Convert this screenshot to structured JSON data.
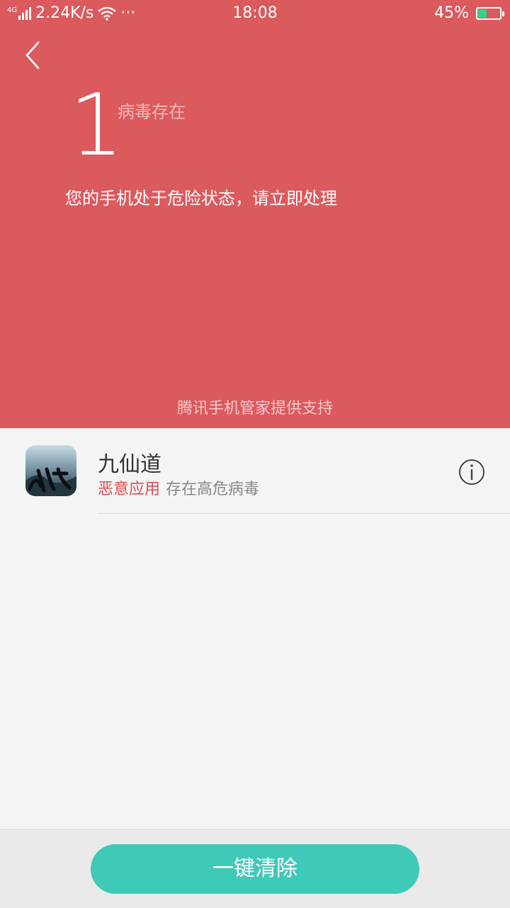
{
  "status_bar": {
    "network": "4G",
    "speed": "2.24K/s",
    "more": "···",
    "time": "18:08",
    "battery_percent": "45%",
    "battery_level": 0.45,
    "battery_color": "#2fd38a"
  },
  "header": {
    "background": "#db5a5e",
    "virus_count": "1",
    "virus_count_label": "病毒存在",
    "warning": "您的手机处于危险状态，请立即处理",
    "powered_by": "腾讯手机管家提供支持"
  },
  "threats": [
    {
      "app_name": "九仙道",
      "tag": "恶意应用",
      "description": "存在高危病毒",
      "icon": "app-icon-jiuxiandao"
    }
  ],
  "actions": {
    "clean_label": "一键清除",
    "clean_color": "#3fcab8"
  }
}
